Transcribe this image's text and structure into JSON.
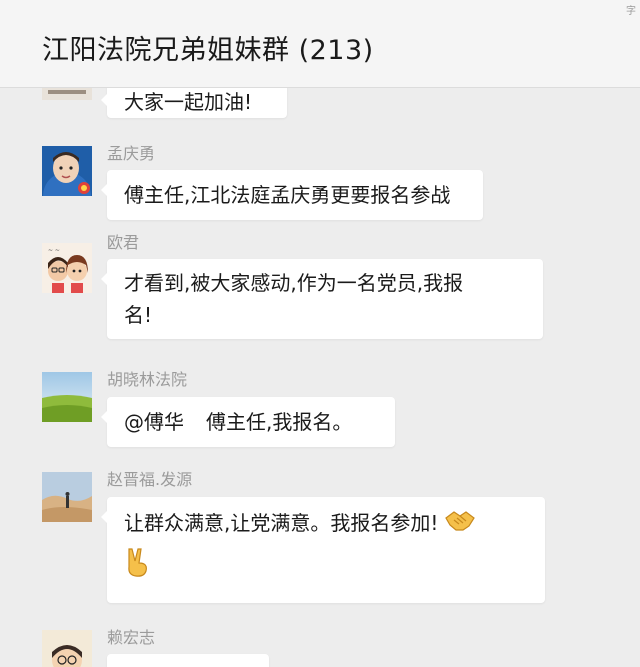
{
  "window": {
    "title": "江阳法院兄弟姐妹群 (213)",
    "corner_mark": "字"
  },
  "messages": [
    {
      "sender": "",
      "text": "大家一起加油!",
      "avatar_icon": "avatar-partial-icon"
    },
    {
      "sender": "孟庆勇",
      "text": "傅主任,江北法庭孟庆勇更要报名参战",
      "avatar_icon": "child-photo-avatar-icon"
    },
    {
      "sender": "欧君",
      "text_line1": "才看到,被大家感动,作为一名党员,我报",
      "text_line2": "名!",
      "avatar_icon": "cartoon-couple-avatar-icon"
    },
    {
      "sender": "胡晓林法院",
      "mention": "@傅华",
      "text": "傅主任,我报名。",
      "avatar_icon": "grassland-avatar-icon"
    },
    {
      "sender": "赵晋福.发源",
      "text": "让群众满意,让党满意。我报名参加!",
      "emoji1": "handshake-emoji",
      "emoji2": "victory-hand-emoji",
      "avatar_icon": "desert-avatar-icon"
    },
    {
      "sender": "赖宏志",
      "text": "",
      "avatar_icon": "cartoon-avatar-icon"
    }
  ],
  "colors": {
    "background": "#ededed",
    "titlebar": "#f5f5f5",
    "bubble": "#ffffff",
    "sender_name": "#9b9b9b",
    "text": "#1b1b1b"
  }
}
